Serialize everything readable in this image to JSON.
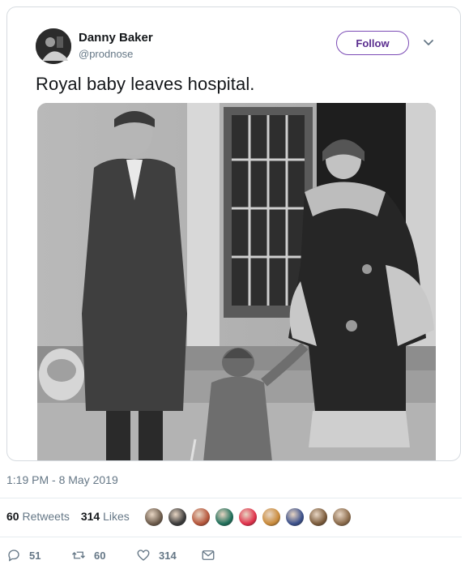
{
  "author": {
    "name": "Danny Baker",
    "handle": "@prodnose",
    "avatar_icon": "profile-photo"
  },
  "follow_label": "Follow",
  "menu_icon": "chevron-down-icon",
  "tweet_text": "Royal baby leaves hospital.",
  "media": {
    "description_icon": "photo-black-and-white"
  },
  "timestamp": "1:19 PM - 8 May 2019",
  "stats": {
    "retweets_count": "60",
    "retweets_label": "Retweets",
    "likes_count": "314",
    "likes_label": "Likes"
  },
  "likers": [
    {
      "color": "#6b5a4a"
    },
    {
      "color": "#3a3a3a"
    },
    {
      "color": "#b5553a"
    },
    {
      "color": "#1f6f5a"
    },
    {
      "color": "#e0304a"
    },
    {
      "color": "#c98a3a"
    },
    {
      "color": "#3a4f8a"
    },
    {
      "color": "#7a5a3a"
    },
    {
      "color": "#8a6a4a"
    }
  ],
  "actions": {
    "reply_count": "51",
    "retweet_count": "60",
    "like_count": "314"
  },
  "colors": {
    "follow_accent": "#7b4bb5",
    "muted_text": "#657786"
  }
}
